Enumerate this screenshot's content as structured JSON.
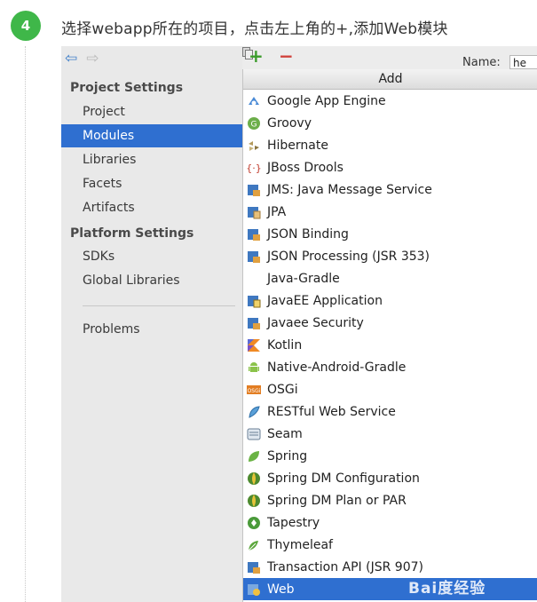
{
  "step": {
    "number": "4",
    "instruction": "选择webapp所在的项目，点击左上角的+,添加Web模块"
  },
  "toolbar": {
    "add": "+",
    "remove": "−",
    "name_label": "Name:",
    "name_value": "he"
  },
  "sidebar": {
    "nav_back": "⇦",
    "nav_forward": "⇨",
    "project_settings_header": "Project Settings",
    "project_items": [
      "Project",
      "Modules",
      "Libraries",
      "Facets",
      "Artifacts"
    ],
    "platform_settings_header": "Platform Settings",
    "platform_items": [
      "SDKs",
      "Global Libraries"
    ],
    "problems": "Problems",
    "selected": "Modules"
  },
  "popup": {
    "header": "Add",
    "items": [
      {
        "label": "Google App Engine",
        "icon": "google-app-engine-icon"
      },
      {
        "label": "Groovy",
        "icon": "groovy-icon"
      },
      {
        "label": "Hibernate",
        "icon": "hibernate-icon"
      },
      {
        "label": "JBoss Drools",
        "icon": "jboss-drools-icon"
      },
      {
        "label": "JMS: Java Message Service",
        "icon": "jms-icon"
      },
      {
        "label": "JPA",
        "icon": "jpa-icon"
      },
      {
        "label": "JSON Binding",
        "icon": "json-binding-icon"
      },
      {
        "label": "JSON Processing (JSR 353)",
        "icon": "json-processing-icon"
      },
      {
        "label": "Java-Gradle",
        "icon": ""
      },
      {
        "label": "JavaEE Application",
        "icon": "javaee-application-icon"
      },
      {
        "label": "Javaee Security",
        "icon": "javaee-security-icon"
      },
      {
        "label": "Kotlin",
        "icon": "kotlin-icon"
      },
      {
        "label": "Native-Android-Gradle",
        "icon": "android-icon"
      },
      {
        "label": "OSGi",
        "icon": "osgi-icon"
      },
      {
        "label": "RESTful Web Service",
        "icon": "restful-icon"
      },
      {
        "label": "Seam",
        "icon": "seam-icon"
      },
      {
        "label": "Spring",
        "icon": "spring-icon"
      },
      {
        "label": "Spring DM Configuration",
        "icon": "spring-dm-icon"
      },
      {
        "label": "Spring DM Plan or PAR",
        "icon": "spring-dm-icon"
      },
      {
        "label": "Tapestry",
        "icon": "tapestry-icon"
      },
      {
        "label": "Thymeleaf",
        "icon": "thymeleaf-icon"
      },
      {
        "label": "Transaction API (JSR 907)",
        "icon": "transaction-icon"
      },
      {
        "label": "Web",
        "icon": "web-icon"
      }
    ],
    "selected": "Web"
  },
  "watermark": "Bai度经验",
  "colors": {
    "step_green": "#3fb749",
    "selection_blue": "#2f6fd0",
    "add_green": "#3a9b2a",
    "remove_red": "#d0403a"
  }
}
